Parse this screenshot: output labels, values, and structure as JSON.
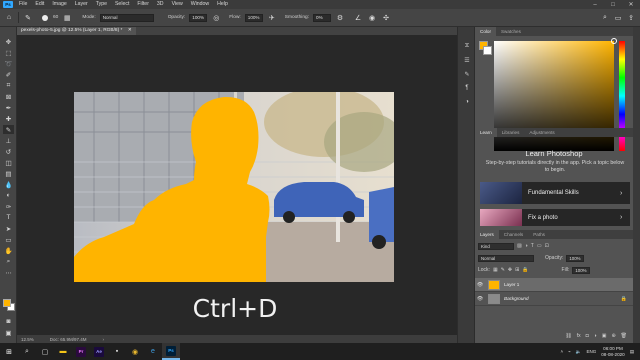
{
  "menu": {
    "logo": "Ps",
    "items": [
      "File",
      "Edit",
      "Image",
      "Layer",
      "Type",
      "Select",
      "Filter",
      "3D",
      "View",
      "Window",
      "Help"
    ]
  },
  "options": {
    "brush_size": "60",
    "mode_label": "Mode:",
    "mode_value": "Normal",
    "opacity_label": "Opacity:",
    "opacity_value": "100%",
    "flow_label": "Flow:",
    "flow_value": "100%",
    "smoothing_label": "Smoothing:",
    "smoothing_value": "0%"
  },
  "document": {
    "tab_title": "pexels-photo-5.jpg @ 12.5% (Layer 1, RGB/8) *",
    "zoom": "12.5%",
    "doc_info": "Doc: 65.9M/97.4M"
  },
  "caption": "Ctrl+D",
  "panels": {
    "color_tabs": [
      "Color",
      "Swatches"
    ],
    "learn_tabs": [
      "Learn",
      "Libraries",
      "Adjustments"
    ],
    "learn_title": "Learn Photoshop",
    "learn_desc": "Step-by-step tutorials directly in the app. Pick a topic below to begin.",
    "cards": [
      "Fundamental Skills",
      "Fix a photo"
    ],
    "layers_tabs": [
      "Layers",
      "Channels",
      "Paths"
    ],
    "kind_label": "Kind",
    "blend_mode": "Normal",
    "opacity_label": "Opacity:",
    "opacity_value": "100%",
    "lock_label": "Lock:",
    "fill_label": "Fill:",
    "fill_value": "100%",
    "layers": [
      "Layer 1",
      "Background"
    ]
  },
  "colors": {
    "foreground": "#ffb400",
    "background": "#ffffff",
    "accent": "#31a8ff"
  },
  "taskbar": {
    "apps": [
      "Pr",
      "Ae",
      "Ps"
    ],
    "lang": "ENG",
    "time": "06:00 PM",
    "date": "08-08-2020"
  }
}
